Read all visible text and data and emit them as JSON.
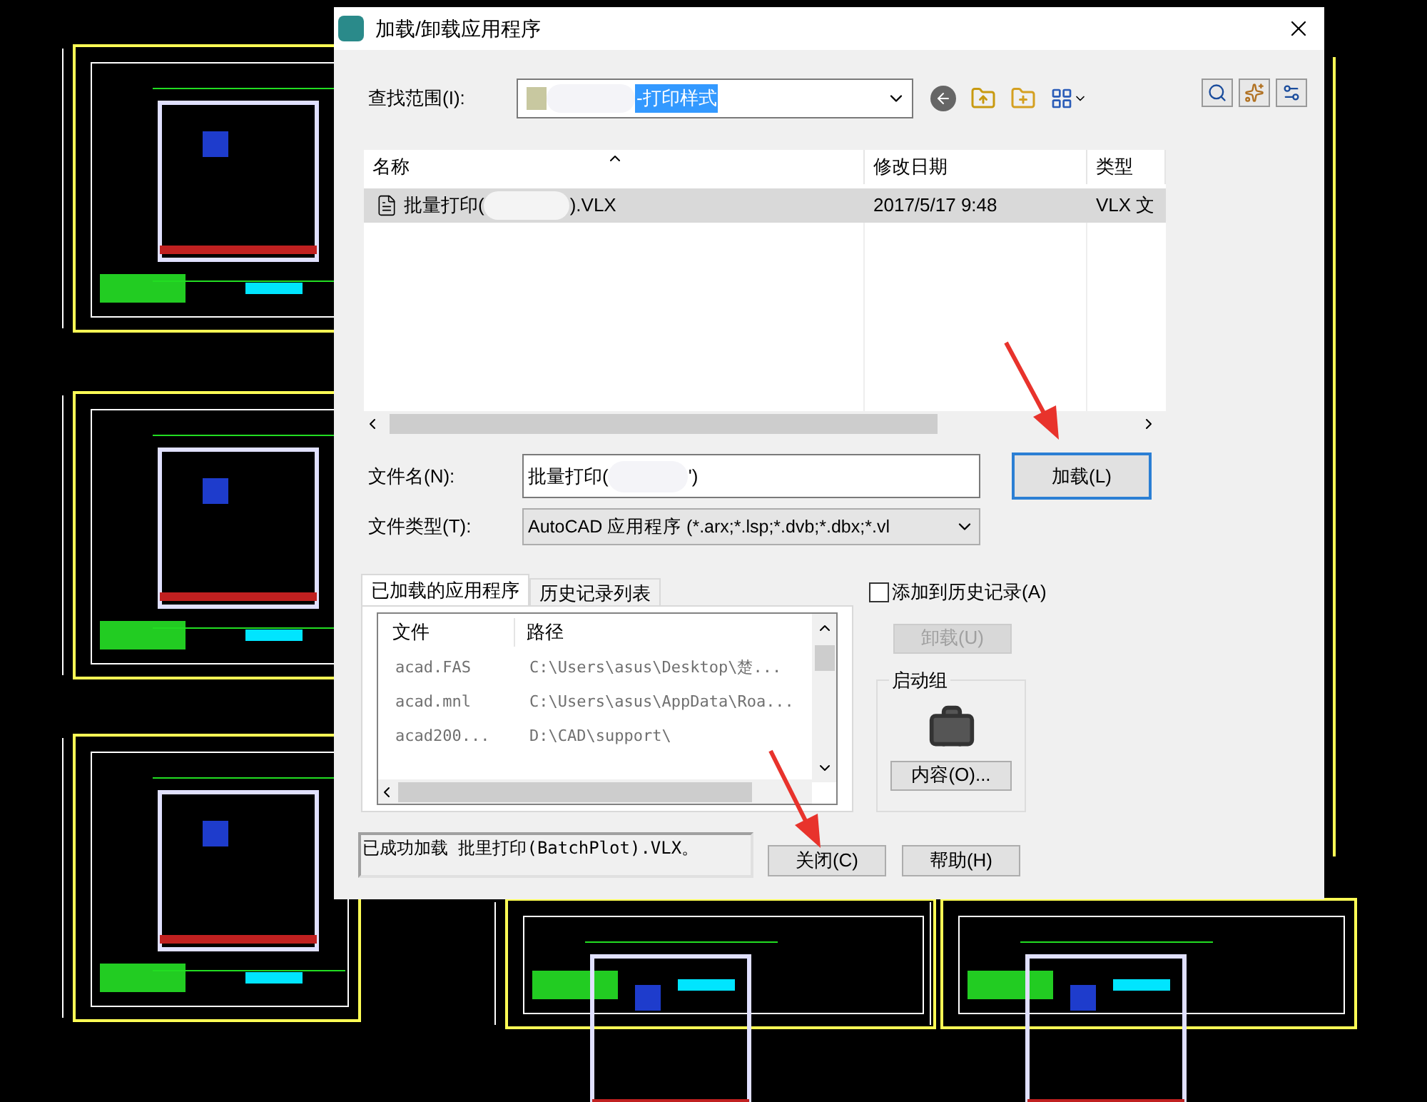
{
  "window": {
    "title": "加载/卸载应用程序"
  },
  "look_in": {
    "label": "查找范围(I):",
    "value": "-打印样式"
  },
  "file_list": {
    "columns": [
      "名称",
      "修改日期",
      "类型"
    ],
    "rows": [
      {
        "name": "批量打印(",
        "name_suffix": ").VLX",
        "modified": "2017/5/17 9:48",
        "type": "VLX 文",
        "selected": true
      }
    ]
  },
  "file_name": {
    "label": "文件名(N):",
    "value": "批量打印(",
    "value_suffix": "')"
  },
  "file_type": {
    "label": "文件类型(T):",
    "value": "AutoCAD 应用程序 (*.arx;*.lsp;*.dvb;*.dbx;*.vl"
  },
  "load_button": "加载(L)",
  "tabs": [
    {
      "label": "已加载的应用程序",
      "selected": true
    },
    {
      "label": "历史记录列表",
      "selected": false
    }
  ],
  "loaded_apps": {
    "columns": [
      "文件",
      "路径"
    ],
    "rows": [
      {
        "file": "acad.FAS",
        "path": "C:\\Users\\asus\\Desktop\\楚..."
      },
      {
        "file": "acad.mnl",
        "path": "C:\\Users\\asus\\AppData\\Roa..."
      },
      {
        "file": "acad200...",
        "path": "D:\\CAD\\support\\"
      }
    ]
  },
  "add_to_history": {
    "label": "添加到历史记录(A)",
    "checked": false
  },
  "unload_button": {
    "label": "卸载(U)",
    "disabled": true
  },
  "startup_suite": {
    "title": "启动组",
    "button": "内容(O)..."
  },
  "status": "已成功加载 批里打印(BatchPlot).VLX。",
  "buttons": [
    {
      "label": "关闭(C)"
    },
    {
      "label": "帮助(H)"
    }
  ]
}
